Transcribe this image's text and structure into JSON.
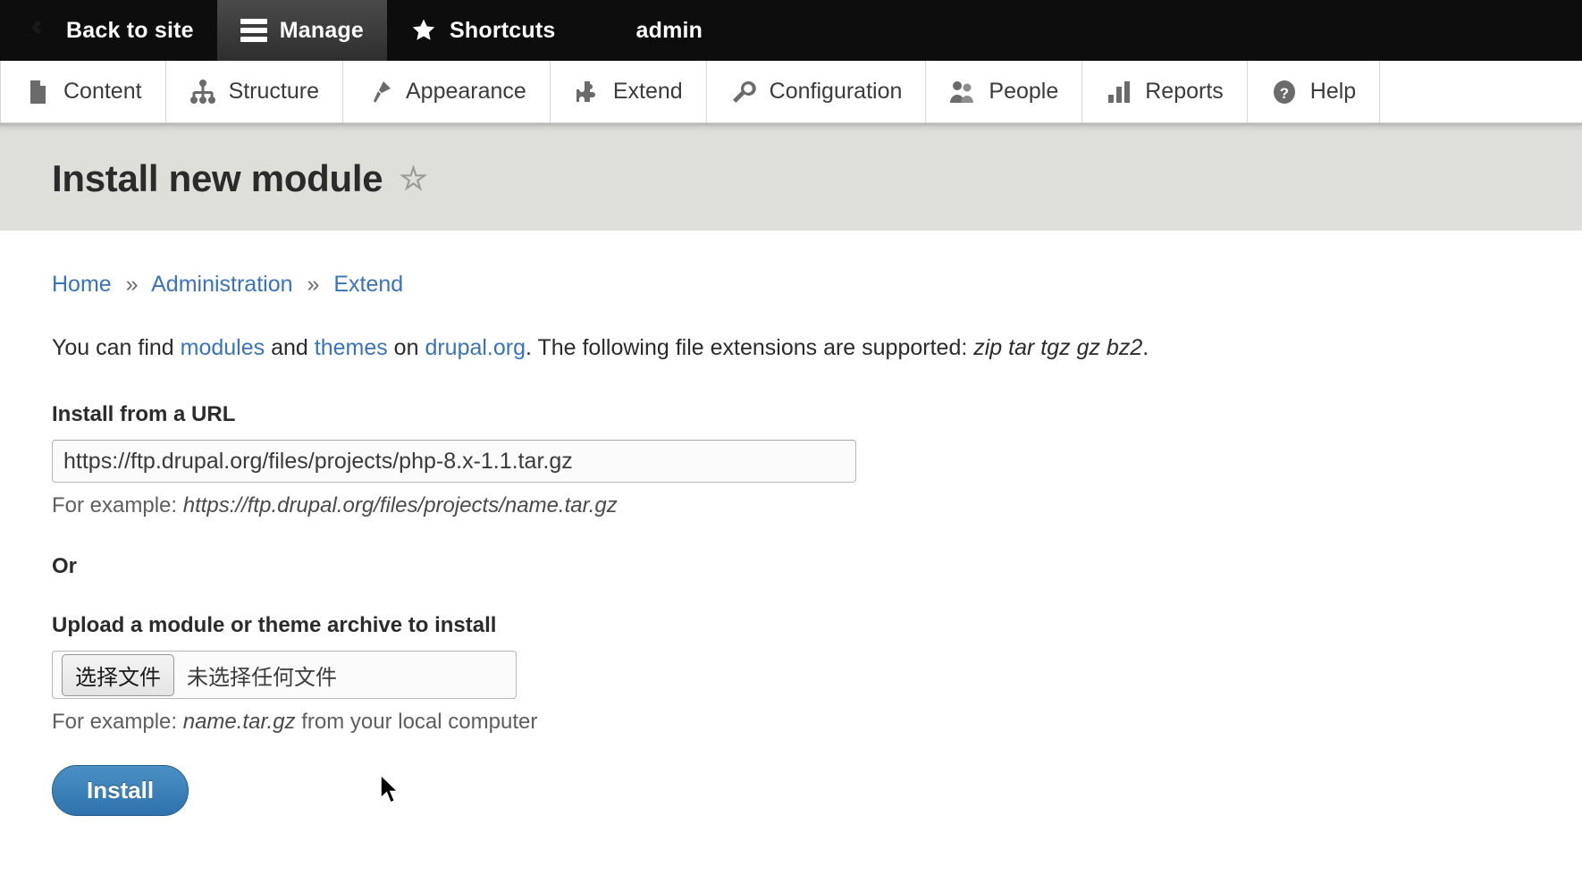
{
  "toolbar": {
    "items": [
      {
        "label": "Back to site",
        "icon": "back-circle-icon",
        "active": false
      },
      {
        "label": "Manage",
        "icon": "hamburger-icon",
        "active": true
      },
      {
        "label": "Shortcuts",
        "icon": "star-icon",
        "active": false
      },
      {
        "label": "admin",
        "icon": "user-icon",
        "active": false
      }
    ]
  },
  "admin_menu": {
    "items": [
      {
        "label": "Content",
        "icon": "document-icon"
      },
      {
        "label": "Structure",
        "icon": "sitemap-icon"
      },
      {
        "label": "Appearance",
        "icon": "paintbrush-icon"
      },
      {
        "label": "Extend",
        "icon": "puzzle-piece-icon"
      },
      {
        "label": "Configuration",
        "icon": "wrench-icon"
      },
      {
        "label": "People",
        "icon": "people-icon"
      },
      {
        "label": "Reports",
        "icon": "bar-chart-icon"
      },
      {
        "label": "Help",
        "icon": "question-mark-icon"
      }
    ]
  },
  "page": {
    "title": "Install new module",
    "bookmark_star": "☆"
  },
  "breadcrumb": {
    "items": [
      "Home",
      "Administration",
      "Extend"
    ],
    "separator": "»"
  },
  "intro": {
    "text_1": "You can find ",
    "link_modules": "modules",
    "text_2": " and ",
    "link_themes": "themes",
    "text_3": " on ",
    "link_drupal": "drupal.org",
    "text_4": ". The following file extensions are supported: ",
    "extensions": "zip tar tgz gz bz2",
    "text_5": "."
  },
  "form": {
    "url_label": "Install from a URL",
    "url_value": "https://ftp.drupal.org/files/projects/php-8.x-1.1.tar.gz",
    "url_placeholder": "",
    "url_hint_prefix": "For example: ",
    "url_hint_example": "https://ftp.drupal.org/files/projects/name.tar.gz",
    "or_label": "Or",
    "upload_label": "Upload a module or theme archive to install",
    "file_button_label": "选择文件",
    "file_status": "未选择任何文件",
    "upload_hint_prefix": "For example: ",
    "upload_hint_example": "name.tar.gz",
    "upload_hint_suffix": " from your local computer",
    "submit_label": "Install"
  },
  "colors": {
    "toolbar_bg": "#0d0d0d",
    "toolbar_active_bg": "#3a3a3a",
    "header_band": "#dfdfda",
    "link": "#3b73b9",
    "primary_button": "#2f72ad",
    "text": "#2b2b2b"
  }
}
